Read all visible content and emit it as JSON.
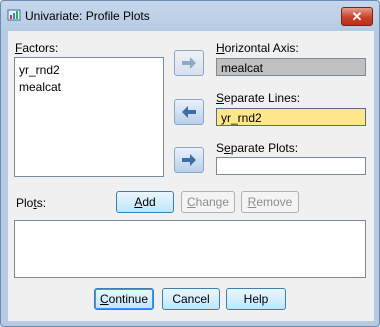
{
  "window": {
    "title": "Univariate: Profile Plots",
    "close_label": "✕"
  },
  "factors": {
    "label_pre": "",
    "label_u": "F",
    "label_post": "actors:",
    "items": [
      "yr_rnd2",
      "mealcat"
    ]
  },
  "horizontal_axis": {
    "label_u": "H",
    "label_post": "orizontal Axis:",
    "value": "mealcat"
  },
  "separate_lines": {
    "label_u": "S",
    "label_post": "eparate Lines:",
    "value": "yr_rnd2"
  },
  "separate_plots": {
    "label_pre": "S",
    "label_u": "e",
    "label_post": "parate Plots:",
    "value": ""
  },
  "plots": {
    "label_pre": "Plo",
    "label_u": "t",
    "label_post": "s:"
  },
  "buttons": {
    "add_u": "A",
    "add_post": "dd",
    "change_u": "C",
    "change_post": "hange",
    "remove_u": "R",
    "remove_post": "emove",
    "continue_u": "C",
    "continue_post": "ontinue",
    "cancel": "Cancel",
    "help": "Help"
  },
  "colors": {
    "horizontal_axis_bg": "#c0c0c0",
    "separate_lines_bg": "#ffe68c",
    "arrow": "#3b6ea8"
  }
}
